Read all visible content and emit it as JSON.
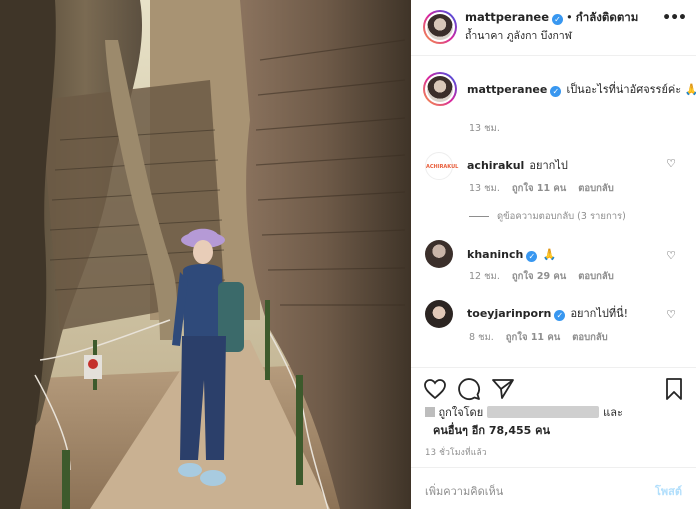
{
  "post": {
    "username": "mattperanee",
    "verified_mark": "✓",
    "separator": "•",
    "follow_state": "กำลังติดตาม",
    "location": "ถ้ำนาคา ภูลังกา บึงกาฬ",
    "more_icon": "•••"
  },
  "caption": {
    "username": "mattperanee",
    "text": "เป็นอะไรที่น่าอัศจรรย์ค่ะ 🙏",
    "time": "13 ชม."
  },
  "comments": [
    {
      "username": "achirakul",
      "verified": false,
      "text": "อยากไป",
      "time": "13 ชม.",
      "likes": "ถูกใจ 11 คน",
      "reply": "ตอบกลับ",
      "view_replies": "ดูข้อความตอบกลับ (3 รายการ)"
    },
    {
      "username": "khaninch",
      "verified": true,
      "text": "🙏",
      "time": "12 ชม.",
      "likes": "ถูกใจ 29 คน",
      "reply": "ตอบกลับ"
    },
    {
      "username": "toeyjarinporn",
      "verified": true,
      "text": "อยากไปที่นี่!",
      "time": "8 ชม.",
      "likes": "ถูกใจ 11 คน",
      "reply": "ตอบกลับ"
    }
  ],
  "likes": {
    "liked_by": "ถูกใจโดย",
    "and": "และ",
    "others": "คนอื่นๆ อีก 78,455 คน"
  },
  "timestamp": "13 ชั่วโมงที่แล้ว",
  "add_comment": {
    "placeholder": "เพิ่มความคิดเห็น",
    "post_label": "โพสต์"
  },
  "icons": {
    "heart": "heart-icon",
    "comment": "comment-icon",
    "share": "share-icon",
    "save": "bookmark-icon"
  },
  "colors": {
    "link_blue": "#3897f0",
    "post_disabled": "#b2dffc",
    "muted": "#8e8e8e"
  }
}
